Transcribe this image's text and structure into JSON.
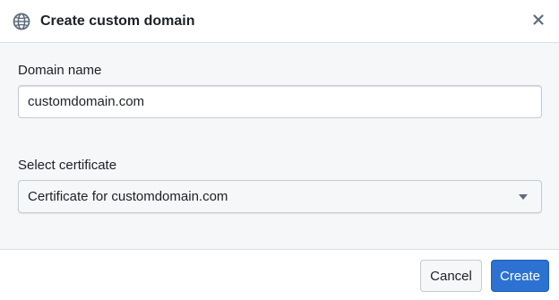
{
  "dialog": {
    "title": "Create custom domain",
    "title_icon": "globe-icon",
    "close_icon": "close-icon"
  },
  "form": {
    "domain_label": "Domain name",
    "domain_value": "customdomain.com",
    "certificate_label": "Select certificate",
    "certificate_value": "Certificate for customdomain.com",
    "certificate_icon": "caret-down-icon"
  },
  "footer": {
    "cancel_label": "Cancel",
    "create_label": "Create"
  },
  "colors": {
    "primary": "#2d72d2",
    "text": "#1c2127",
    "background": "#f6f7f9"
  }
}
